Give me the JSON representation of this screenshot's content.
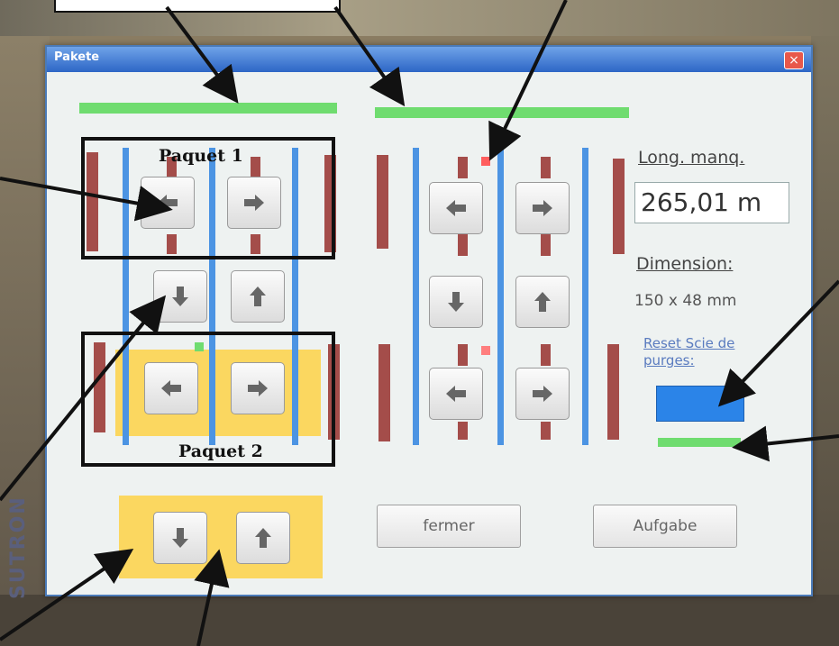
{
  "window": {
    "title": "Pakete",
    "close_symbol": "×"
  },
  "info": {
    "long_manq_label": "Long. manq.",
    "long_manq_value": "265,01 m",
    "dimension_label": "Dimension:",
    "dimension_value": "150 x 48 mm",
    "reset_label": "Reset Scie de purges:"
  },
  "buttons": {
    "fermer": "fermer",
    "aufgabe": "Aufgabe"
  },
  "annotations": {
    "paquet1": "Paquet 1",
    "paquet2": "Paquet 2"
  },
  "brand": "SUTRON",
  "colors": {
    "rail": "#4c94e3",
    "post": "#a44d4a",
    "status": "#6fdc6f",
    "pad": "#fbd760",
    "reset": "#2b84e8"
  }
}
